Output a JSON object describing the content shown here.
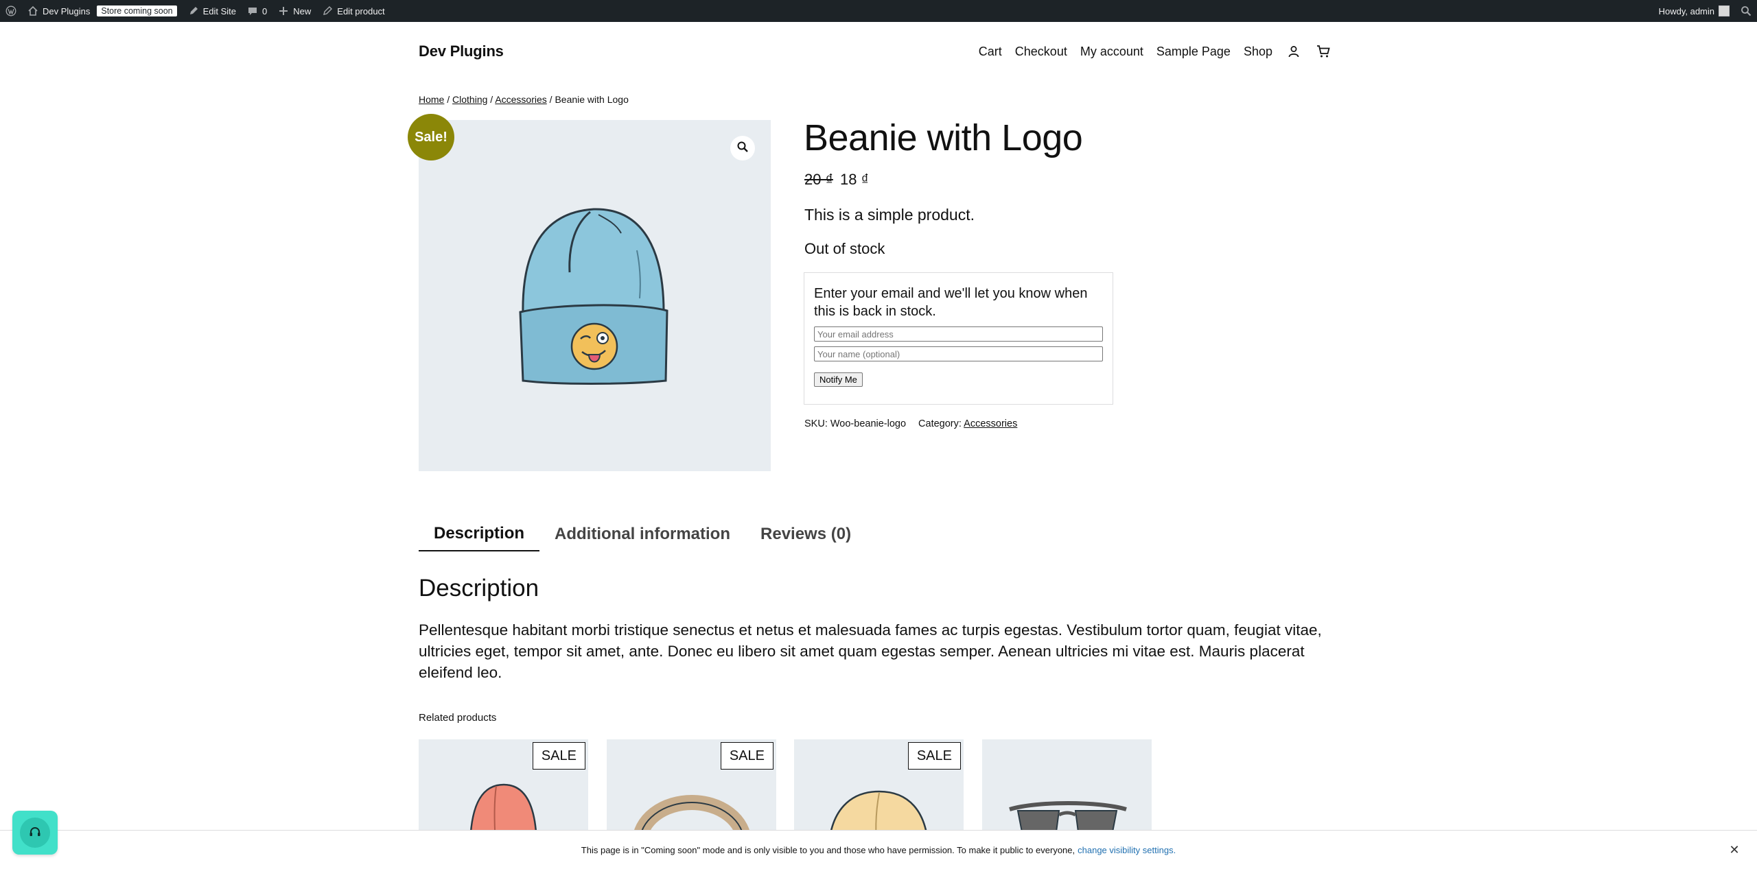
{
  "admin_bar": {
    "site_name": "Dev Plugins",
    "badge": "Store coming soon",
    "edit_site": "Edit Site",
    "comments_count": "0",
    "new_label": "New",
    "edit_product": "Edit product",
    "howdy": "Howdy, admin"
  },
  "header": {
    "site_title": "Dev Plugins",
    "nav": [
      "Cart",
      "Checkout",
      "My account",
      "Sample Page",
      "Shop"
    ]
  },
  "breadcrumb": {
    "home": "Home",
    "clothing": "Clothing",
    "accessories": "Accessories",
    "current": "Beanie with Logo",
    "separator": "/"
  },
  "product": {
    "sale_badge": "Sale!",
    "title": "Beanie with Logo",
    "price_old": "20 ₫",
    "price_new": "18 ₫",
    "short_description": "This is a simple product.",
    "stock": "Out of stock",
    "notify": {
      "text": "Enter your email and we'll let you know when this is back in stock.",
      "email_placeholder": "Your email address",
      "name_placeholder": "Your name (optional)",
      "button": "Notify Me"
    },
    "sku_label": "SKU:",
    "sku": "Woo-beanie-logo",
    "category_label": "Category:",
    "category": "Accessories"
  },
  "tabs": [
    "Description",
    "Additional information",
    "Reviews (0)"
  ],
  "description": {
    "heading": "Description",
    "body": "Pellentesque habitant morbi tristique senectus et netus et malesuada fames ac turpis egestas. Vestibulum tortor quam, feugiat vitae, ultricies eget, tempor sit amet, ante. Donec eu libero sit amet quam egestas semper. Aenean ultricies mi vitae est. Mauris placerat eleifend leo."
  },
  "related": {
    "heading": "Related products",
    "sale_label": "SALE"
  },
  "notice": {
    "text": "This page is in \"Coming soon\" mode and is only visible to you and those who have permission. To make it public to everyone,",
    "link": "change visibility settings."
  },
  "colors": {
    "admin_bar_bg": "#1d2327",
    "sale_badge": "#8b8708",
    "gallery_bg": "#e8edf1",
    "chat_button": "#41e0c9",
    "notice_link": "#2271b1"
  },
  "icons": [
    "wordpress-icon",
    "home-icon",
    "pencil-icon",
    "comment-icon",
    "plus-icon",
    "search-icon",
    "account-icon",
    "cart-icon",
    "zoom-icon",
    "headset-icon",
    "close-icon"
  ]
}
